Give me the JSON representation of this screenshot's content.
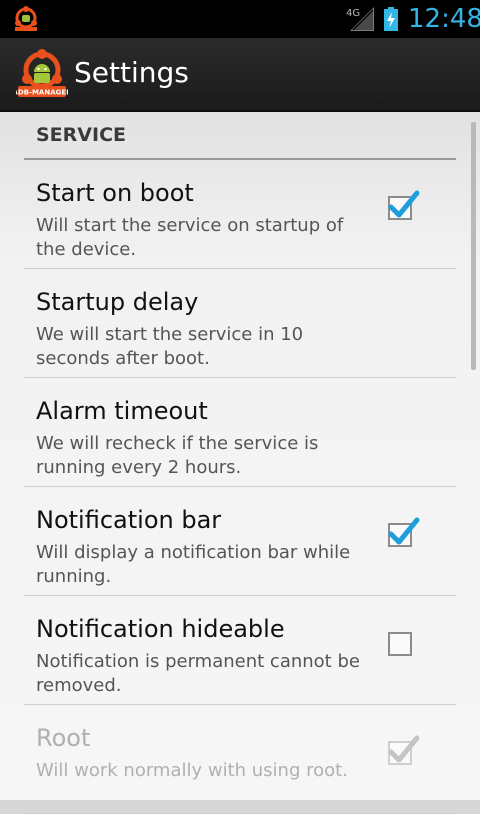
{
  "status_bar": {
    "network": "4G",
    "time": "12:48",
    "icons": [
      "app-notification-icon",
      "signal-icon",
      "battery-charging-icon"
    ]
  },
  "action_bar": {
    "title": "Settings",
    "logo_icon": "adb-manager-logo-icon",
    "logo_caption": "ADB-MANAGER"
  },
  "section": {
    "header": "SERVICE"
  },
  "preferences": [
    {
      "title": "Start on boot",
      "summary": "Will start the service on startup of the device.",
      "checkbox": true,
      "checked": true,
      "enabled": true
    },
    {
      "title": "Startup delay",
      "summary": "We will start the service in 10 seconds after boot.",
      "checkbox": false,
      "enabled": true
    },
    {
      "title": "Alarm timeout",
      "summary": "We will recheck if the service is running every 2 hours.",
      "checkbox": false,
      "enabled": true
    },
    {
      "title": "Notification bar",
      "summary": "Will display a notification bar while running.",
      "checkbox": true,
      "checked": true,
      "enabled": true
    },
    {
      "title": "Notification hideable",
      "summary": "Notification is permanent cannot be removed.",
      "checkbox": true,
      "checked": false,
      "enabled": true
    },
    {
      "title": "Root",
      "summary": "Will work normally with using root.",
      "checkbox": true,
      "checked": true,
      "enabled": false
    }
  ],
  "colors": {
    "accent": "#33b5e5",
    "check_blue": "#1e9fdc",
    "action_bar": "#222222",
    "logo_orange": "#e8501e"
  }
}
